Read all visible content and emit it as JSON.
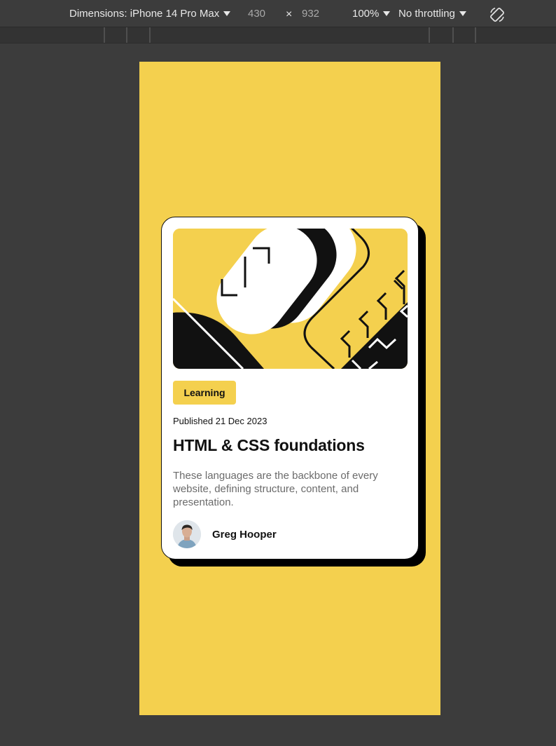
{
  "toolbar": {
    "dimensions_label": "Dimensions: iPhone 14 Pro Max",
    "width_value": "430",
    "times_symbol": "×",
    "height_value": "932",
    "zoom_label": "100%",
    "throttling_label": "No throttling",
    "rotate_icon": "rotate-icon",
    "dropdown_icon": "caret-down-icon"
  },
  "card": {
    "tag": "Learning",
    "published": "Published 21 Dec 2023",
    "title": "HTML & CSS foundations",
    "description": "These languages are the backbone of every website, defining structure, content, and presentation.",
    "author": "Greg Hooper"
  },
  "colors": {
    "viewport_background": "#f4d04e",
    "card_background": "#ffffff",
    "card_shadow": "#000000",
    "text_primary": "#111111",
    "text_secondary": "#6b6b6b",
    "devtools_background": "#3c3c3c"
  }
}
